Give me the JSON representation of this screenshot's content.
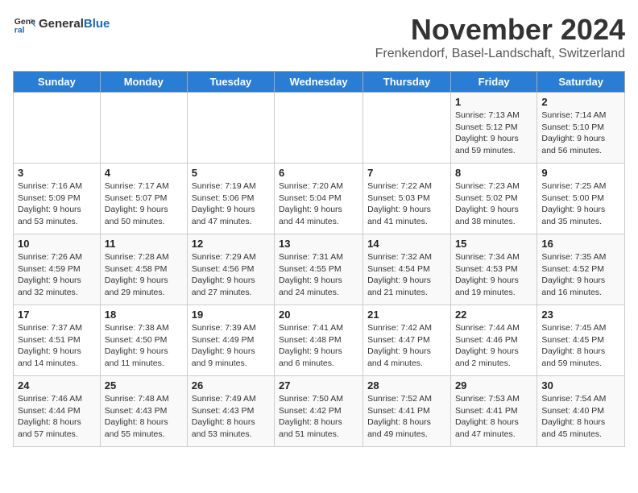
{
  "logo": {
    "line1": "General",
    "line2": "Blue"
  },
  "title": "November 2024",
  "subtitle": "Frenkendorf, Basel-Landschaft, Switzerland",
  "headers": [
    "Sunday",
    "Monday",
    "Tuesday",
    "Wednesday",
    "Thursday",
    "Friday",
    "Saturday"
  ],
  "weeks": [
    [
      {
        "day": "",
        "info": ""
      },
      {
        "day": "",
        "info": ""
      },
      {
        "day": "",
        "info": ""
      },
      {
        "day": "",
        "info": ""
      },
      {
        "day": "",
        "info": ""
      },
      {
        "day": "1",
        "info": "Sunrise: 7:13 AM\nSunset: 5:12 PM\nDaylight: 9 hours\nand 59 minutes."
      },
      {
        "day": "2",
        "info": "Sunrise: 7:14 AM\nSunset: 5:10 PM\nDaylight: 9 hours\nand 56 minutes."
      }
    ],
    [
      {
        "day": "3",
        "info": "Sunrise: 7:16 AM\nSunset: 5:09 PM\nDaylight: 9 hours\nand 53 minutes."
      },
      {
        "day": "4",
        "info": "Sunrise: 7:17 AM\nSunset: 5:07 PM\nDaylight: 9 hours\nand 50 minutes."
      },
      {
        "day": "5",
        "info": "Sunrise: 7:19 AM\nSunset: 5:06 PM\nDaylight: 9 hours\nand 47 minutes."
      },
      {
        "day": "6",
        "info": "Sunrise: 7:20 AM\nSunset: 5:04 PM\nDaylight: 9 hours\nand 44 minutes."
      },
      {
        "day": "7",
        "info": "Sunrise: 7:22 AM\nSunset: 5:03 PM\nDaylight: 9 hours\nand 41 minutes."
      },
      {
        "day": "8",
        "info": "Sunrise: 7:23 AM\nSunset: 5:02 PM\nDaylight: 9 hours\nand 38 minutes."
      },
      {
        "day": "9",
        "info": "Sunrise: 7:25 AM\nSunset: 5:00 PM\nDaylight: 9 hours\nand 35 minutes."
      }
    ],
    [
      {
        "day": "10",
        "info": "Sunrise: 7:26 AM\nSunset: 4:59 PM\nDaylight: 9 hours\nand 32 minutes."
      },
      {
        "day": "11",
        "info": "Sunrise: 7:28 AM\nSunset: 4:58 PM\nDaylight: 9 hours\nand 29 minutes."
      },
      {
        "day": "12",
        "info": "Sunrise: 7:29 AM\nSunset: 4:56 PM\nDaylight: 9 hours\nand 27 minutes."
      },
      {
        "day": "13",
        "info": "Sunrise: 7:31 AM\nSunset: 4:55 PM\nDaylight: 9 hours\nand 24 minutes."
      },
      {
        "day": "14",
        "info": "Sunrise: 7:32 AM\nSunset: 4:54 PM\nDaylight: 9 hours\nand 21 minutes."
      },
      {
        "day": "15",
        "info": "Sunrise: 7:34 AM\nSunset: 4:53 PM\nDaylight: 9 hours\nand 19 minutes."
      },
      {
        "day": "16",
        "info": "Sunrise: 7:35 AM\nSunset: 4:52 PM\nDaylight: 9 hours\nand 16 minutes."
      }
    ],
    [
      {
        "day": "17",
        "info": "Sunrise: 7:37 AM\nSunset: 4:51 PM\nDaylight: 9 hours\nand 14 minutes."
      },
      {
        "day": "18",
        "info": "Sunrise: 7:38 AM\nSunset: 4:50 PM\nDaylight: 9 hours\nand 11 minutes."
      },
      {
        "day": "19",
        "info": "Sunrise: 7:39 AM\nSunset: 4:49 PM\nDaylight: 9 hours\nand 9 minutes."
      },
      {
        "day": "20",
        "info": "Sunrise: 7:41 AM\nSunset: 4:48 PM\nDaylight: 9 hours\nand 6 minutes."
      },
      {
        "day": "21",
        "info": "Sunrise: 7:42 AM\nSunset: 4:47 PM\nDaylight: 9 hours\nand 4 minutes."
      },
      {
        "day": "22",
        "info": "Sunrise: 7:44 AM\nSunset: 4:46 PM\nDaylight: 9 hours\nand 2 minutes."
      },
      {
        "day": "23",
        "info": "Sunrise: 7:45 AM\nSunset: 4:45 PM\nDaylight: 8 hours\nand 59 minutes."
      }
    ],
    [
      {
        "day": "24",
        "info": "Sunrise: 7:46 AM\nSunset: 4:44 PM\nDaylight: 8 hours\nand 57 minutes."
      },
      {
        "day": "25",
        "info": "Sunrise: 7:48 AM\nSunset: 4:43 PM\nDaylight: 8 hours\nand 55 minutes."
      },
      {
        "day": "26",
        "info": "Sunrise: 7:49 AM\nSunset: 4:43 PM\nDaylight: 8 hours\nand 53 minutes."
      },
      {
        "day": "27",
        "info": "Sunrise: 7:50 AM\nSunset: 4:42 PM\nDaylight: 8 hours\nand 51 minutes."
      },
      {
        "day": "28",
        "info": "Sunrise: 7:52 AM\nSunset: 4:41 PM\nDaylight: 8 hours\nand 49 minutes."
      },
      {
        "day": "29",
        "info": "Sunrise: 7:53 AM\nSunset: 4:41 PM\nDaylight: 8 hours\nand 47 minutes."
      },
      {
        "day": "30",
        "info": "Sunrise: 7:54 AM\nSunset: 4:40 PM\nDaylight: 8 hours\nand 45 minutes."
      }
    ]
  ]
}
